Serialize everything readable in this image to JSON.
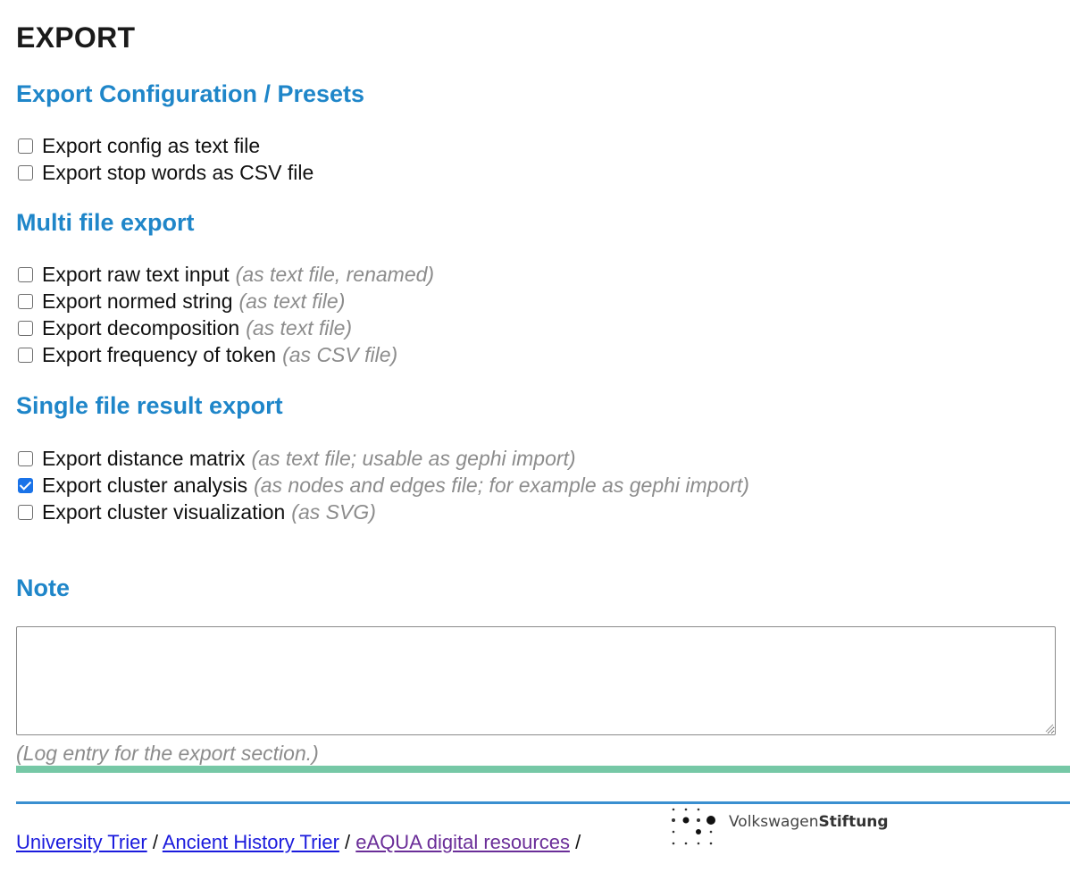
{
  "page_title": "EXPORT",
  "sections": {
    "config": {
      "heading": "Export Configuration / Presets",
      "options": [
        {
          "label": "Export config as text file",
          "hint": "",
          "checked": false
        },
        {
          "label": "Export stop words as CSV file",
          "hint": "",
          "checked": false
        }
      ]
    },
    "multi": {
      "heading": "Multi file export",
      "options": [
        {
          "label": "Export raw text input",
          "hint": "(as text file, renamed)",
          "checked": false
        },
        {
          "label": "Export normed string",
          "hint": "(as text file)",
          "checked": false
        },
        {
          "label": "Export decomposition",
          "hint": "(as text file)",
          "checked": false
        },
        {
          "label": "Export frequency of token",
          "hint": "(as CSV file)",
          "checked": false
        }
      ]
    },
    "single": {
      "heading": "Single file result export",
      "options": [
        {
          "label": "Export distance matrix",
          "hint": "(as text file; usable as gephi import)",
          "checked": false
        },
        {
          "label": "Export cluster analysis",
          "hint": "(as nodes and edges file; for example as gephi import)",
          "checked": true
        },
        {
          "label": "Export cluster visualization",
          "hint": "(as SVG)",
          "checked": false
        }
      ]
    },
    "note": {
      "heading": "Note",
      "value": "",
      "caption": "(Log entry for the export section.)"
    }
  },
  "footer": {
    "links": [
      {
        "label": "University Trier",
        "visited": false
      },
      {
        "label": "Ancient History Trier",
        "visited": false
      },
      {
        "label": "eAQUA digital resources",
        "visited": true
      }
    ],
    "separator": "/",
    "logo_text_regular": "Volkswagen",
    "logo_text_bold": "Stiftung"
  },
  "colors": {
    "heading": "#1f86c9",
    "green_rule": "#76c8a6",
    "blue_rule": "#3a8fd0",
    "checkbox_checked": "#1a73e8",
    "hint": "#8c8c8c"
  }
}
